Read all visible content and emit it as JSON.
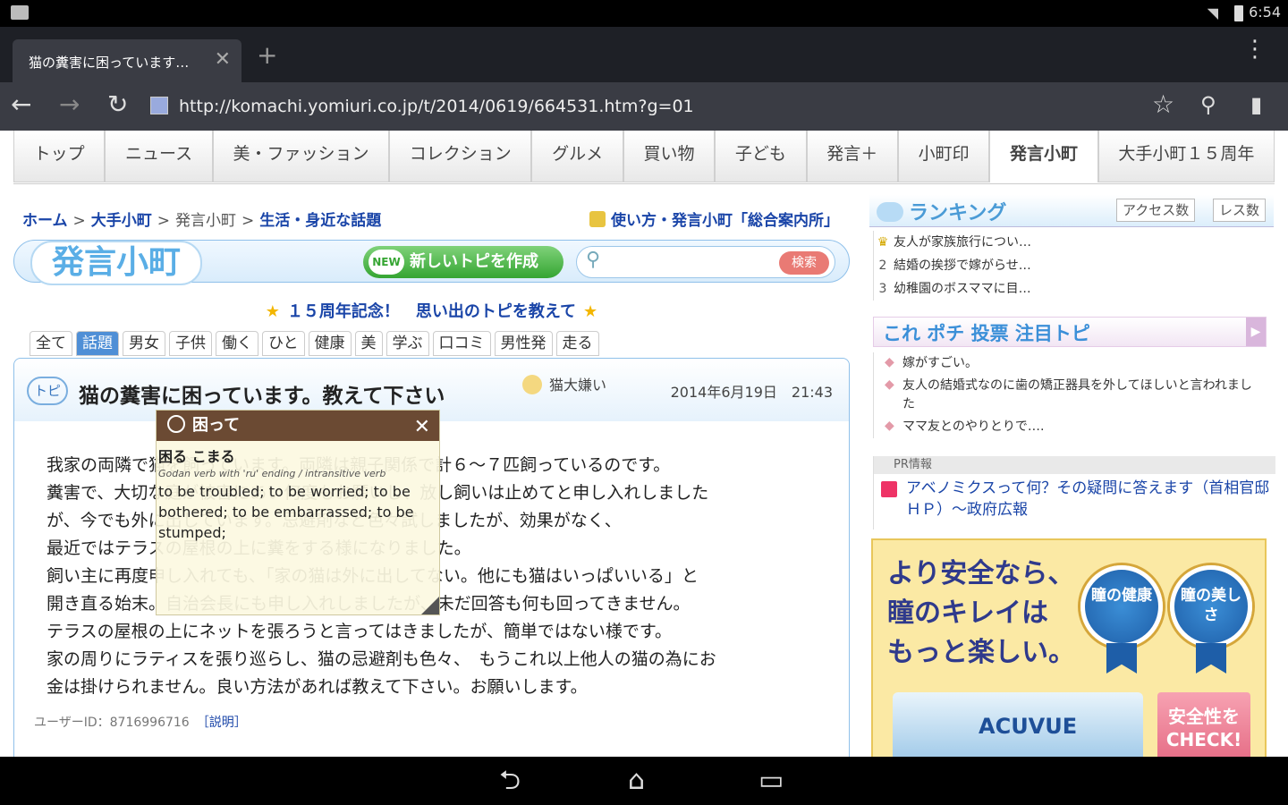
{
  "status": {
    "time": "6:54"
  },
  "browser": {
    "tab_title": "猫の糞害に困っています…",
    "tab_close": "✕",
    "new_tab": "+",
    "menu": "⋮",
    "url": "http://komachi.yomiuri.co.jp/t/2014/0619/664531.htm?g=01"
  },
  "nav": {
    "items": [
      "トップ",
      "ニュース",
      "美・ファッション",
      "コレクション",
      "グルメ",
      "買い物",
      "子ども",
      "発言＋",
      "小町印",
      "発言小町",
      "大手小町１５周年"
    ],
    "active_index": 9
  },
  "crumbs": {
    "home": "ホーム",
    "sep": ">",
    "c1": "大手小町",
    "c2": "発言小町",
    "c3": "生活・身近な話題",
    "guide": "使い方・発言小町「総合案内所」"
  },
  "header": {
    "logo": "発言小町",
    "new_badge": "NEW",
    "new_topic": "新しいトピを作成",
    "search_placeholder": "",
    "search_button": "検索"
  },
  "anniversary": {
    "star": "★",
    "text": "１５周年記念！　思い出のトピを教えて"
  },
  "categories": {
    "items": [
      "全て",
      "話題",
      "男女",
      "子供",
      "働く",
      "ひと",
      "健康",
      "美",
      "学ぶ",
      "口コミ",
      "男性発",
      "走る"
    ],
    "active_index": 1
  },
  "topic": {
    "tobi": "トピ",
    "title": "猫の糞害に困っています。教えて下さい",
    "author": "猫大嫌い",
    "date": "2014年6月19日　21:43",
    "body_lines": [
      "我家の両隣で猫を飼っています。両隣は親子関係で計６～７匹飼っているのです。",
      "糞害で、大切な庭が被害にあい何度もお願いし、放し飼いは止めてと申し入れしました",
      "が、今でも外に出しています。忌避剤など色々試しましたが、効果がなく、",
      "最近ではテラスの屋根の上に糞をする様になりました。",
      "飼い主に再度申し入れても、「家の猫は外に出してない。他にも猫はいっぱいいる」と",
      "開き直る始末。自治会長にも申し入れしましたが、未だ回答も何も回ってきません。",
      "テラスの屋根の上にネットを張ろうと言ってはきましたが、簡単ではない様です。",
      "家の周りにラティスを張り巡らし、猫の忌避剤も色々、　もうこれ以上他人の猫の為にお",
      "金は掛けられません。良い方法があれば教えて下さい。お願いします。"
    ],
    "user_id": "ユーザーID：8716996716",
    "explain": "［説明］"
  },
  "popup": {
    "head": "困って",
    "close": "✕",
    "word": "困る こまる",
    "grammar": "Godan verb with 'ru' ending / intransitive verb",
    "definition": "to be troubled; to be worried; to be bothered; to be embarrassed; to be stumped;"
  },
  "ranking": {
    "title": "ランキング",
    "tab_access": "アクセス数",
    "tab_res": "レス数",
    "items": [
      {
        "n": "♛",
        "text": "友人が家族旅行につい…"
      },
      {
        "n": "2",
        "text": "結婚の挨拶で嫁がらせ…"
      },
      {
        "n": "3",
        "text": "幼稚園のボスママに目…"
      }
    ]
  },
  "vote": {
    "title": "これ ポチ 投票 注目トピ",
    "arrow": "▶",
    "items": [
      "嫁がすごい。",
      "友人の結婚式なのに歯の矯正器具を外してほしいと言われました",
      "ママ友とのやりとりで‥‥"
    ]
  },
  "pr": {
    "label": "PR情報",
    "text": "アベノミクスって何？その疑問に答えます（首相官邸ＨＰ）～政府広報"
  },
  "ad": {
    "line1": "より安全なら、",
    "line2": "瞳のキレイは",
    "line3": "もっと楽しい。",
    "badge1": "瞳の健康",
    "badge2": "瞳の美しさ",
    "product": "ACUVUE",
    "cta": "安全性をCHECK!"
  },
  "system": {
    "back": "⮌",
    "home": "⌂",
    "recent": "▭"
  }
}
